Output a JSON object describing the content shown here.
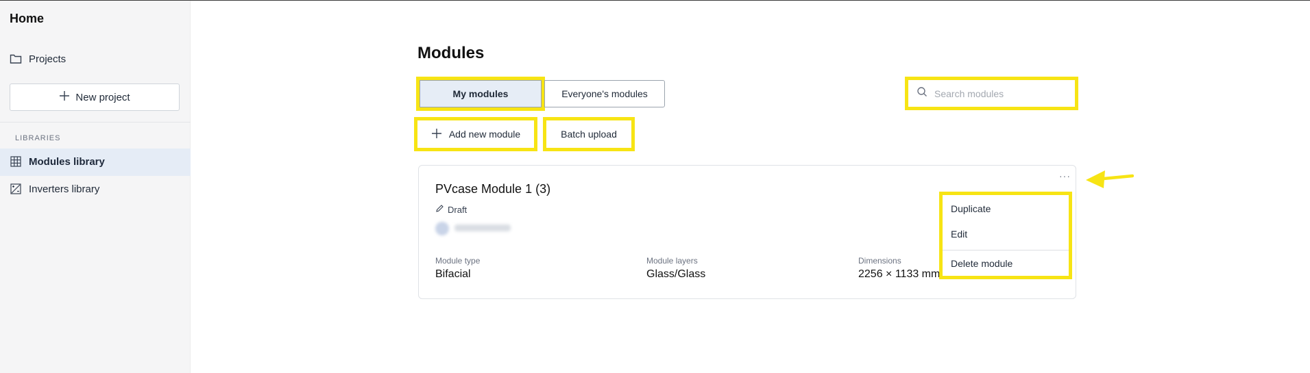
{
  "sidebar": {
    "home": "Home",
    "projects": "Projects",
    "new_project": "New project",
    "section_libraries": "LIBRARIES",
    "modules_library": "Modules library",
    "inverters_library": "Inverters library"
  },
  "main": {
    "title": "Modules",
    "tabs": [
      {
        "label": "My modules",
        "active": true
      },
      {
        "label": "Everyone's modules",
        "active": false
      }
    ],
    "search": {
      "placeholder": "Search modules"
    },
    "actions": {
      "add_new": "Add new module",
      "batch_upload": "Batch upload"
    }
  },
  "card": {
    "title": "PVcase Module 1 (3)",
    "status": "Draft",
    "more": "···",
    "meta": [
      {
        "label": "Module type",
        "value": "Bifacial"
      },
      {
        "label": "Module layers",
        "value": "Glass/Glass"
      },
      {
        "label": "Dimensions",
        "value": "2256 × 1133 mm"
      }
    ]
  },
  "context_menu": {
    "items": [
      "Duplicate",
      "Edit",
      "Delete module"
    ]
  },
  "colors": {
    "highlight": "#f7e414",
    "active_bg": "#e6edf6",
    "sidebar_bg": "#f5f5f6"
  }
}
